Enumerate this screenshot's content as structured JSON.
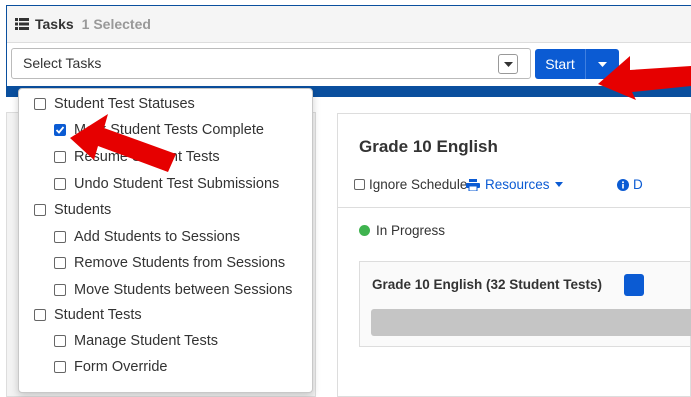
{
  "tasks_panel": {
    "title": "Tasks",
    "selected_count": "1 Selected",
    "select_placeholder": "Select Tasks",
    "start_label": "Start"
  },
  "menu": {
    "groups": [
      {
        "label": "Student Test Statuses",
        "checked": false,
        "items": [
          {
            "label": "Mark Student Tests Complete",
            "checked": true
          },
          {
            "label": "Resume Student Tests",
            "checked": false
          },
          {
            "label": "Undo Student Test Submissions",
            "checked": false
          }
        ]
      },
      {
        "label": "Students",
        "checked": false,
        "items": [
          {
            "label": "Add Students to Sessions",
            "checked": false
          },
          {
            "label": "Remove Students from Sessions",
            "checked": false
          },
          {
            "label": "Move Students between Sessions",
            "checked": false
          }
        ]
      },
      {
        "label": "Student Tests",
        "checked": false,
        "items": [
          {
            "label": "Manage Student Tests",
            "checked": false
          },
          {
            "label": "Form Override",
            "checked": false
          }
        ]
      }
    ]
  },
  "session": {
    "title": "Grade 10 English",
    "ignore_schedule": "Ignore Schedule",
    "resources": "Resources",
    "info_label": "D",
    "status": "In Progress",
    "tests_title": "Grade 10 English (32 Student Tests)"
  },
  "colors": {
    "primary": "#0b5bd3",
    "panel_border": "#0a4f9e",
    "status_green": "#3fb34f",
    "annotation_arrow": "#e60000"
  }
}
